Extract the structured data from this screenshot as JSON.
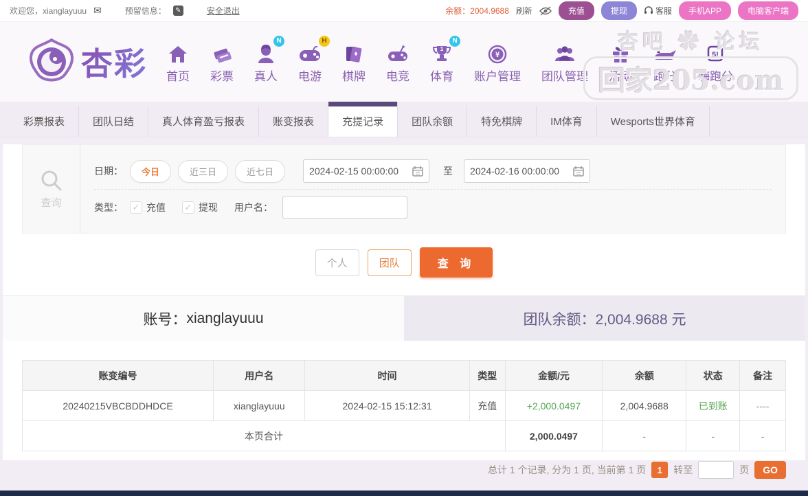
{
  "topbar": {
    "welcome": "欢迎您，xianglayuuu",
    "reserved_label": "预留信息：",
    "logout": "安全退出",
    "balance_label": "余额：",
    "balance_value": "2004.9688",
    "refresh": "刷新",
    "deposit": "充值",
    "withdraw": "提现",
    "service": "客服",
    "mobile_app": "手机APP",
    "pc_client": "电脑客户端"
  },
  "brand": {
    "name": "杏彩"
  },
  "nav": {
    "items": [
      {
        "label": "首页",
        "badge": ""
      },
      {
        "label": "彩票",
        "badge": ""
      },
      {
        "label": "真人",
        "badge": "N"
      },
      {
        "label": "电游",
        "badge": "H"
      },
      {
        "label": "棋牌",
        "badge": ""
      },
      {
        "label": "电竞",
        "badge": ""
      },
      {
        "label": "体育",
        "badge": "N"
      },
      {
        "label": "账户管理",
        "badge": ""
      },
      {
        "label": "团队管理",
        "badge": ""
      },
      {
        "label": "活动",
        "badge": ""
      },
      {
        "label": "跑分",
        "badge": ""
      },
      {
        "label": "嗨跑分",
        "badge": ""
      }
    ]
  },
  "watermark": {
    "line1": "杏吧 ✿ 论坛",
    "line2": "回家205.com"
  },
  "tabs": {
    "items": [
      "彩票报表",
      "团队日结",
      "真人体育盈亏报表",
      "账变报表",
      "充提记录",
      "团队余额",
      "特免棋牌",
      "IM体育",
      "Wesports世界体育"
    ],
    "active": "充提记录"
  },
  "filter": {
    "panel_label": "查询",
    "date_label": "日期：",
    "quick_today": "今日",
    "quick_3d": "近三日",
    "quick_7d": "近七日",
    "date_from": "2024-02-15 00:00:00",
    "to_label": "至",
    "date_to": "2024-02-16 00:00:00",
    "type_label": "类型：",
    "type_deposit": "充值",
    "type_withdraw": "提现",
    "check_mark": "✓",
    "username_label": "用户名：",
    "username_value": ""
  },
  "actions": {
    "personal": "个人",
    "team": "团队",
    "query": "查 询"
  },
  "summary": {
    "account_label": "账号：",
    "account_value": "xianglayuuu",
    "team_balance_label": "团队余额：",
    "team_balance_value": "2,004.9688 元"
  },
  "table": {
    "headers": [
      "账变编号",
      "用户名",
      "时间",
      "类型",
      "金额/元",
      "余额",
      "状态",
      "备注"
    ],
    "rows": [
      {
        "change_id": "20240215VBCBDDHDCE",
        "username": "xianglayuuu",
        "time": "2024-02-15 15:12:31",
        "type": "充值",
        "amount": "+2,000.0497",
        "balance": "2,004.9688",
        "status": "已到账",
        "remark": "----"
      }
    ],
    "total_label": "本页合计",
    "total_amount": "2,000.0497",
    "total_balance": "-",
    "total_status": "-",
    "total_remark": "-"
  },
  "pagination": {
    "summary": "总计 1 个记录, 分为 1 页, 当前第 1 页",
    "current": "1",
    "goto_label": "转至",
    "page_label": "页",
    "go": "GO"
  },
  "colors": {
    "accent_orange": "#ec6a2f",
    "balance_red": "#e2603c",
    "green_ok": "#55a352",
    "nav_purple": "#8a5fb0",
    "tab_active_bar": "#5d4a7d"
  }
}
